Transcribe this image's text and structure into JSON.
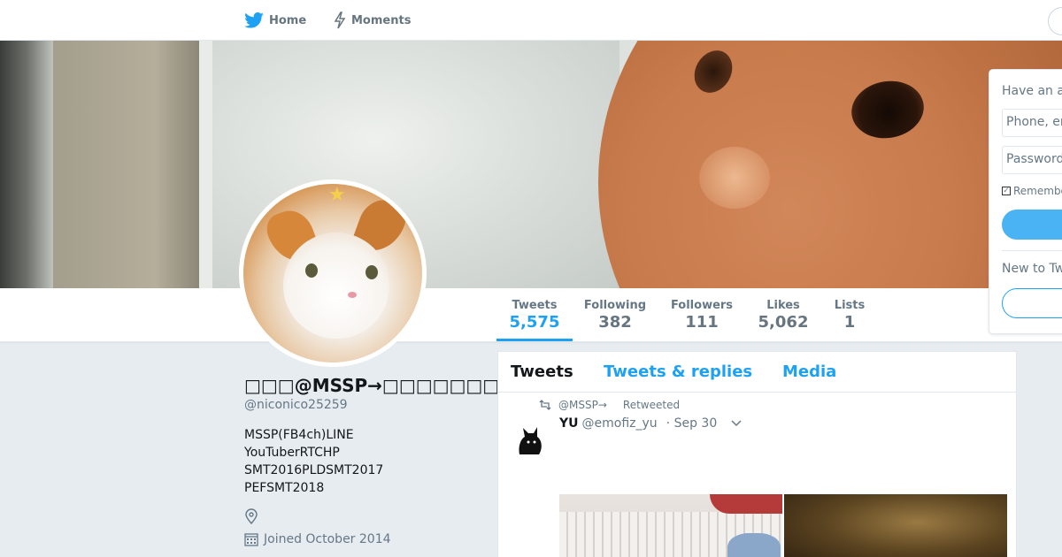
{
  "nav": {
    "home_label": "Home",
    "moments_label": "Moments"
  },
  "profile": {
    "name": "□□□@MSSP→□□□□□□□",
    "handle": "@niconico25259",
    "bio_lines": [
      "MSSP(FB4ch)LINE",
      "YouTuberRTCHP",
      "SMT2016PLDSMT2017",
      "PEFSMT2018"
    ],
    "joined": "Joined October 2014"
  },
  "stats": [
    {
      "label": "Tweets",
      "value": "5,575"
    },
    {
      "label": "Following",
      "value": "382"
    },
    {
      "label": "Followers",
      "value": "111"
    },
    {
      "label": "Likes",
      "value": "5,062"
    },
    {
      "label": "Lists",
      "value": "1"
    }
  ],
  "tabs": [
    "Tweets",
    "Tweets & replies",
    "Media"
  ],
  "tweet": {
    "retweeter": "@MSSP→",
    "retweet_label": "Retweeted",
    "author_name": "YU",
    "author_handle": "@emofiz_yu",
    "date": "· Sep 30"
  },
  "login": {
    "title": "Have an a",
    "phone_placeholder": "Phone, er",
    "password_placeholder": "Password",
    "remember_label": "Remembe",
    "new_label": "New to Tw"
  },
  "colors": {
    "accent": "#1da1f2",
    "background": "#e6ecf0"
  }
}
